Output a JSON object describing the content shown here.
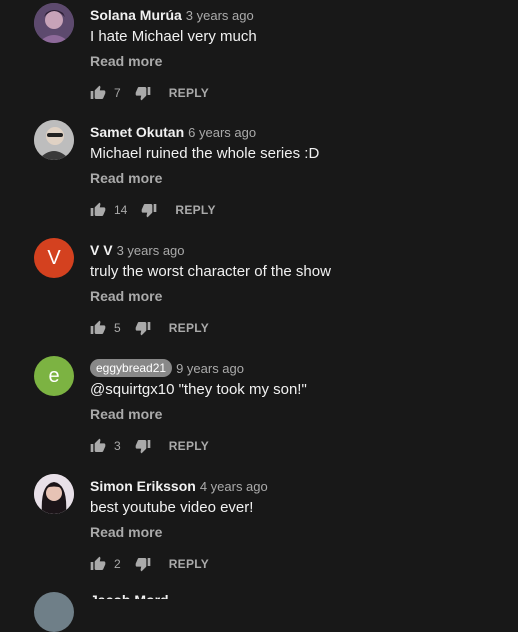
{
  "comments": [
    {
      "author": "Solana Murúa",
      "time": "3 years ago",
      "text": "I hate Michael very much",
      "read_more": "Read more",
      "likes": "7",
      "reply": "REPLY",
      "avatar_color": "#7a5c8a",
      "avatar_icon": "profile-photo"
    },
    {
      "author": "Samet Okutan",
      "time": "6 years ago",
      "text": "Michael ruined the whole series :D",
      "read_more": "Read more",
      "likes": "14",
      "reply": "REPLY",
      "avatar_color": "#9a9a9a",
      "avatar_icon": "profile-photo"
    },
    {
      "author": "V V",
      "time": "3 years ago",
      "text": "truly the worst character of the show",
      "read_more": "Read more",
      "likes": "5",
      "reply": "REPLY",
      "avatar_color": "#d4411f",
      "avatar_letter": "V"
    },
    {
      "author": "eggybread21",
      "time": "9 years ago",
      "text": "@squirtgx10 \"they took my son!\"",
      "read_more": "Read more",
      "likes": "3",
      "reply": "REPLY",
      "avatar_color": "#7cb342",
      "avatar_letter": "e"
    },
    {
      "author": "Simon Eriksson",
      "time": "4 years ago",
      "text": "best youtube video ever!",
      "read_more": "Read more",
      "likes": "2",
      "reply": "REPLY",
      "avatar_color": "#cfc4cf",
      "avatar_icon": "profile-photo"
    }
  ],
  "partial_comment": {
    "author": "Jacob Mord"
  },
  "icons": {
    "like": "thumb-up-icon",
    "dislike": "thumb-down-icon"
  }
}
